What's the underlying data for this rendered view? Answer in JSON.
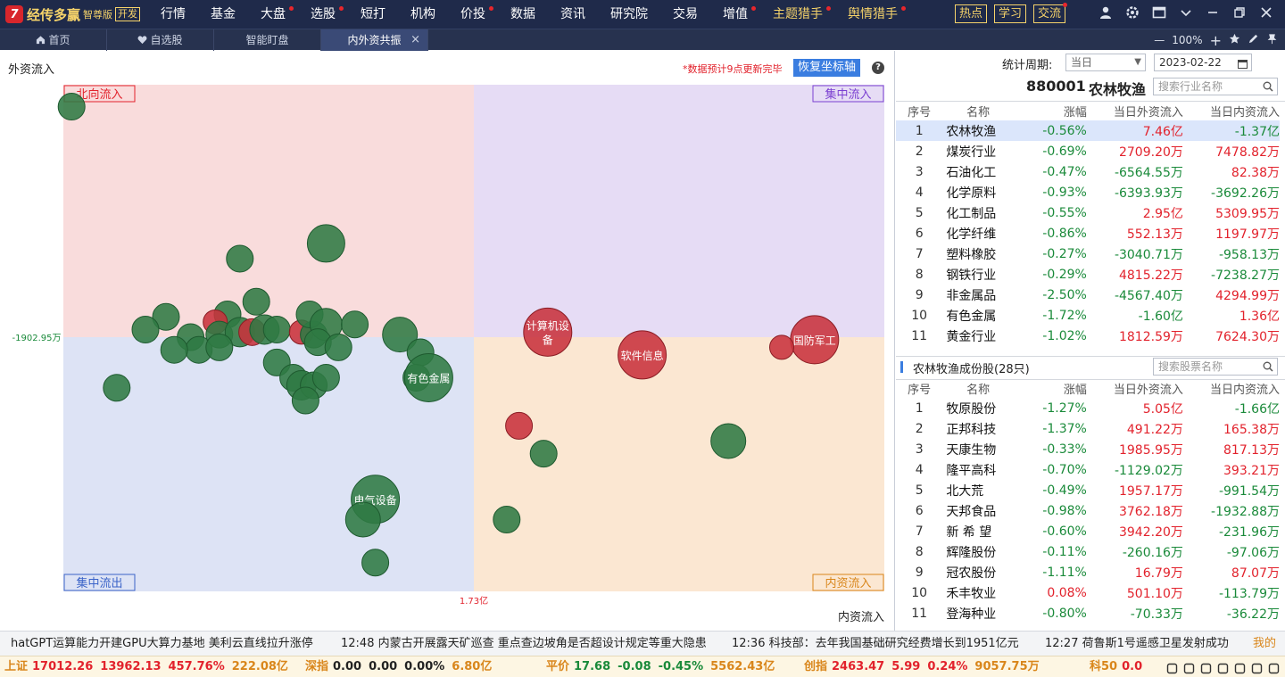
{
  "app": {
    "logo_mark": "7",
    "name": "经传多赢",
    "edition": "智尊版",
    "dev_badge": "开发"
  },
  "menu": [
    {
      "label": "行情",
      "dot": false,
      "gold": false
    },
    {
      "label": "基金",
      "dot": false,
      "gold": false
    },
    {
      "label": "大盘",
      "dot": true,
      "gold": false
    },
    {
      "label": "选股",
      "dot": true,
      "gold": false
    },
    {
      "label": "短打",
      "dot": false,
      "gold": false
    },
    {
      "label": "机构",
      "dot": false,
      "gold": false
    },
    {
      "label": "价投",
      "dot": true,
      "gold": false
    },
    {
      "label": "数据",
      "dot": false,
      "gold": false
    },
    {
      "label": "资讯",
      "dot": false,
      "gold": false
    },
    {
      "label": "研究院",
      "dot": false,
      "gold": false
    },
    {
      "label": "交易",
      "dot": false,
      "gold": false
    },
    {
      "label": "增值",
      "dot": true,
      "gold": false
    },
    {
      "label": "主题猎手",
      "dot": true,
      "gold": true
    },
    {
      "label": "舆情猎手",
      "dot": true,
      "gold": true
    }
  ],
  "quick_buttons": [
    {
      "label": "热点",
      "dot": false
    },
    {
      "label": "学习",
      "dot": false
    },
    {
      "label": "交流",
      "dot": true
    }
  ],
  "window_icons": [
    "user-icon",
    "gear-icon",
    "layout-icon",
    "chevron-down-icon",
    "minimize-icon",
    "restore-icon",
    "close-icon"
  ],
  "tabs": [
    {
      "label": "首页",
      "icon": "home-icon",
      "active": false,
      "closable": false
    },
    {
      "label": "自选股",
      "icon": "heart-icon",
      "active": false,
      "closable": false
    },
    {
      "label": "智能盯盘",
      "icon": "",
      "active": false,
      "closable": false
    },
    {
      "label": "内外资共振",
      "icon": "",
      "active": true,
      "closable": true
    }
  ],
  "zoom": {
    "minus": "—",
    "level": "100%",
    "plus": "+"
  },
  "chart_header": {
    "y_axis_label": "外资流入",
    "notice": "*数据预计9点更新完毕",
    "reset_button": "恢复坐标轴",
    "help": "?"
  },
  "chart_data": {
    "type": "scatter",
    "xlabel": "内资流入",
    "ylabel": "外资流入",
    "x_center_label": "1.73亿",
    "y_center_label": "-1902.95万",
    "quadrants": {
      "top_left": "北向流入",
      "top_right": "集中流入",
      "bottom_left": "集中流出",
      "bottom_right": "内资流入"
    },
    "colors": {
      "up": "#c8323c",
      "down": "#2f7a43",
      "q_top_left": "#f9dcdc",
      "q_top_right": "#e6dcf5",
      "q_bottom_left": "#dde3f5",
      "q_bottom_right": "#fbe7d2"
    },
    "points": [
      {
        "label": "",
        "color": "down",
        "x": -0.98,
        "y": 0.91,
        "r": 1.0
      },
      {
        "label": "",
        "color": "down",
        "x": -0.36,
        "y": 0.37,
        "r": 1.4
      },
      {
        "label": "",
        "color": "down",
        "x": -0.57,
        "y": 0.31,
        "r": 1.0
      },
      {
        "label": "",
        "color": "down",
        "x": -0.53,
        "y": 0.14,
        "r": 1.0
      },
      {
        "label": "",
        "color": "down",
        "x": -0.75,
        "y": 0.08,
        "r": 1.0
      },
      {
        "label": "",
        "color": "down",
        "x": -0.6,
        "y": 0.09,
        "r": 1.0
      },
      {
        "label": "",
        "color": "down",
        "x": -0.8,
        "y": 0.03,
        "r": 1.0
      },
      {
        "label": "",
        "color": "up",
        "x": -0.63,
        "y": 0.06,
        "r": 0.9
      },
      {
        "label": "",
        "color": "down",
        "x": -0.69,
        "y": 0.0,
        "r": 1.0
      },
      {
        "label": "",
        "color": "down",
        "x": -0.67,
        "y": -0.05,
        "r": 1.0
      },
      {
        "label": "",
        "color": "down",
        "x": -0.62,
        "y": 0.01,
        "r": 1.0
      },
      {
        "label": "",
        "color": "down",
        "x": -0.57,
        "y": 0.02,
        "r": 1.1
      },
      {
        "label": "",
        "color": "up",
        "x": -0.54,
        "y": 0.02,
        "r": 1.0
      },
      {
        "label": "",
        "color": "down",
        "x": -0.51,
        "y": 0.03,
        "r": 1.1
      },
      {
        "label": "",
        "color": "down",
        "x": -0.48,
        "y": 0.03,
        "r": 1.0
      },
      {
        "label": "",
        "color": "up",
        "x": -0.42,
        "y": 0.02,
        "r": 0.9
      },
      {
        "label": "",
        "color": "down",
        "x": -0.39,
        "y": 0.01,
        "r": 1.0
      },
      {
        "label": "",
        "color": "down",
        "x": -0.4,
        "y": 0.09,
        "r": 1.0
      },
      {
        "label": "",
        "color": "down",
        "x": -0.36,
        "y": 0.05,
        "r": 1.2
      },
      {
        "label": "",
        "color": "down",
        "x": -0.38,
        "y": -0.02,
        "r": 1.0
      },
      {
        "label": "",
        "color": "down",
        "x": -0.29,
        "y": 0.05,
        "r": 1.0
      },
      {
        "label": "",
        "color": "down",
        "x": -0.18,
        "y": 0.01,
        "r": 1.3
      },
      {
        "label": "",
        "color": "down",
        "x": -0.13,
        "y": -0.06,
        "r": 1.0
      },
      {
        "label": "",
        "color": "down",
        "x": -0.33,
        "y": -0.04,
        "r": 1.0
      },
      {
        "label": "",
        "color": "down",
        "x": -0.62,
        "y": -0.04,
        "r": 1.0
      },
      {
        "label": "",
        "color": "down",
        "x": -0.73,
        "y": -0.05,
        "r": 1.0
      },
      {
        "label": "",
        "color": "down",
        "x": -0.48,
        "y": -0.1,
        "r": 1.0
      },
      {
        "label": "",
        "color": "down",
        "x": -0.44,
        "y": -0.16,
        "r": 1.0
      },
      {
        "label": "",
        "color": "down",
        "x": -0.42,
        "y": -0.19,
        "r": 1.1
      },
      {
        "label": "",
        "color": "down",
        "x": -0.39,
        "y": -0.19,
        "r": 1.0
      },
      {
        "label": "",
        "color": "down",
        "x": -0.36,
        "y": -0.16,
        "r": 1.0
      },
      {
        "label": "",
        "color": "down",
        "x": -0.41,
        "y": -0.25,
        "r": 1.0
      },
      {
        "label": "",
        "color": "down",
        "x": -0.14,
        "y": -0.16,
        "r": 1.0
      },
      {
        "label": "",
        "color": "down",
        "x": -0.87,
        "y": -0.2,
        "r": 1.0
      },
      {
        "label": "有色金属",
        "color": "down",
        "x": -0.11,
        "y": -0.16,
        "r": 1.8
      },
      {
        "label": "电气设备",
        "color": "down",
        "x": -0.24,
        "y": -0.64,
        "r": 1.8
      },
      {
        "label": "",
        "color": "down",
        "x": -0.27,
        "y": -0.72,
        "r": 1.3
      },
      {
        "label": "",
        "color": "down",
        "x": -0.24,
        "y": -0.89,
        "r": 1.0
      },
      {
        "label": "计算机设备",
        "color": "up",
        "x": 0.18,
        "y": 0.02,
        "r": 1.8
      },
      {
        "label": "软件信息",
        "color": "up",
        "x": 0.41,
        "y": -0.07,
        "r": 1.8
      },
      {
        "label": "国防军工",
        "color": "up",
        "x": 0.83,
        "y": -0.01,
        "r": 1.8
      },
      {
        "label": "",
        "color": "up",
        "x": 0.75,
        "y": -0.04,
        "r": 0.9
      },
      {
        "label": "",
        "color": "up",
        "x": 0.11,
        "y": -0.35,
        "r": 1.0
      },
      {
        "label": "",
        "color": "down",
        "x": 0.17,
        "y": -0.46,
        "r": 1.0
      },
      {
        "label": "",
        "color": "down",
        "x": 0.62,
        "y": -0.41,
        "r": 1.3
      },
      {
        "label": "",
        "color": "down",
        "x": 0.08,
        "y": -0.72,
        "r": 1.0
      }
    ]
  },
  "sector_controls": {
    "period_label": "统计周期:",
    "period_value": "当日",
    "date_value": "2023-02-22",
    "code": "880001",
    "name": "农林牧渔",
    "search_placeholder": "搜索行业名称"
  },
  "sector_table": {
    "columns": [
      "序号",
      "名称",
      "涨幅",
      "当日外资流入",
      "当日内资流入"
    ],
    "rows": [
      [
        "1",
        "农林牧渔",
        "-0.56%",
        "7.46亿",
        "-1.37亿"
      ],
      [
        "2",
        "煤炭行业",
        "-0.69%",
        "2709.20万",
        "7478.82万"
      ],
      [
        "3",
        "石油化工",
        "-0.47%",
        "-6564.55万",
        "82.38万"
      ],
      [
        "4",
        "化学原料",
        "-0.93%",
        "-6393.93万",
        "-3692.26万"
      ],
      [
        "5",
        "化工制品",
        "-0.55%",
        "2.95亿",
        "5309.95万"
      ],
      [
        "6",
        "化学纤维",
        "-0.86%",
        "552.13万",
        "1197.97万"
      ],
      [
        "7",
        "塑料橡胶",
        "-0.27%",
        "-3040.71万",
        "-958.13万"
      ],
      [
        "8",
        "钢铁行业",
        "-0.29%",
        "4815.22万",
        "-7238.27万"
      ],
      [
        "9",
        "非金属品",
        "-2.50%",
        "-4567.40万",
        "4294.99万"
      ],
      [
        "10",
        "有色金属",
        "-1.72%",
        "-1.60亿",
        "1.36亿"
      ],
      [
        "11",
        "黄金行业",
        "-1.02%",
        "1812.59万",
        "7624.30万"
      ]
    ]
  },
  "stock_section": {
    "title": "农林牧渔成份股(28只)",
    "search_placeholder": "搜索股票名称"
  },
  "stock_table": {
    "columns": [
      "序号",
      "名称",
      "涨幅",
      "当日外资流入",
      "当日内资流入"
    ],
    "rows": [
      [
        "1",
        "牧原股份",
        "-1.27%",
        "5.05亿",
        "-1.66亿"
      ],
      [
        "2",
        "正邦科技",
        "-1.37%",
        "491.22万",
        "165.38万"
      ],
      [
        "3",
        "天康生物",
        "-0.33%",
        "1985.95万",
        "817.13万"
      ],
      [
        "4",
        "隆平高科",
        "-0.70%",
        "-1129.02万",
        "393.21万"
      ],
      [
        "5",
        "北大荒",
        "-0.49%",
        "1957.17万",
        "-991.54万"
      ],
      [
        "6",
        "天邦食品",
        "-0.98%",
        "3762.18万",
        "-1932.88万"
      ],
      [
        "7",
        "新 希 望",
        "-0.60%",
        "3942.20万",
        "-231.96万"
      ],
      [
        "8",
        "辉隆股份",
        "-0.11%",
        "-260.16万",
        "-97.06万"
      ],
      [
        "9",
        "冠农股份",
        "-1.11%",
        "16.79万",
        "87.07万"
      ],
      [
        "10",
        "禾丰牧业",
        "0.08%",
        "501.10万",
        "-113.79万"
      ],
      [
        "11",
        "登海种业",
        "-0.80%",
        "-70.33万",
        "-36.22万"
      ]
    ]
  },
  "news_ticker": [
    "hatGPT运算能力开建GPU大算力基地 美利云直线拉升涨停",
    "12:48 内蒙古开展露天矿巡查 重点查边坡角是否超设计规定等重大隐患",
    "12:36 科技部：去年我国基础研究经费增长到1951亿元",
    "12:27 荷鲁斯1号遥感卫星发射成功",
    "我的"
  ],
  "indices": [
    {
      "name": "上证",
      "v1": "17012.26",
      "v2": "13962.13",
      "v3": "457.76%",
      "v4": "222.08亿"
    },
    {
      "name": "深指",
      "v1": "0.00",
      "v2": "0.00",
      "v3": "0.00%",
      "v4": "6.80亿"
    },
    {
      "name": "平价",
      "v1": "17.68",
      "v2": "-0.08",
      "v3": "-0.45%",
      "v4": "5562.43亿"
    },
    {
      "name": "创指",
      "v1": "2463.47",
      "v2": "5.99",
      "v3": "0.24%",
      "v4": "9057.75万"
    },
    {
      "name": "科50",
      "v1": "0.0",
      "v2": "",
      "v3": "",
      "v4": ""
    }
  ]
}
